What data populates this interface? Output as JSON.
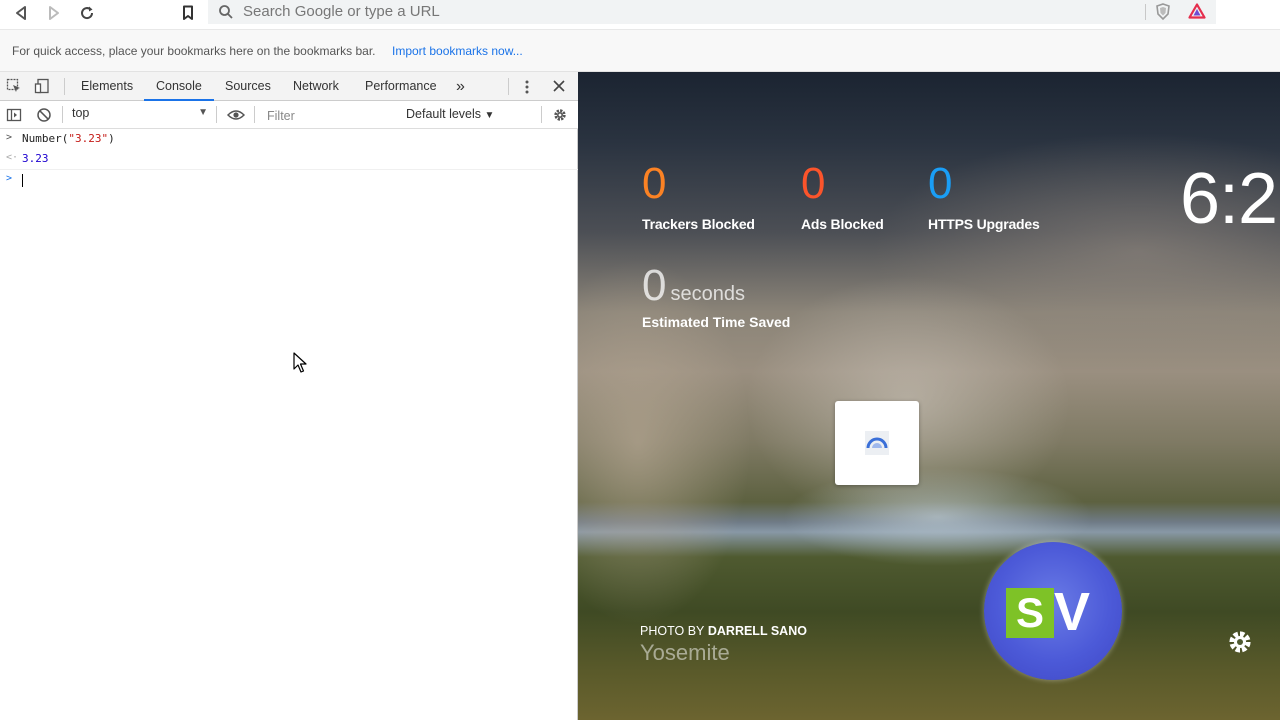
{
  "toolbar": {
    "url_placeholder": "Search Google or type a URL",
    "icons": [
      "back-icon",
      "forward-icon",
      "reload-icon",
      "bookmark-icon",
      "search-icon",
      "brave-shield-icon",
      "brave-rewards-icon"
    ]
  },
  "bookmarks_bar": {
    "hint": "For quick access, place your bookmarks here on the bookmarks bar.",
    "import_link": "Import bookmarks now..."
  },
  "devtools": {
    "tabs": [
      {
        "label": "Elements",
        "active": false
      },
      {
        "label": "Console",
        "active": true
      },
      {
        "label": "Sources",
        "active": false
      },
      {
        "label": "Network",
        "active": false
      },
      {
        "label": "Performance",
        "active": false
      }
    ],
    "more_tabs": "»",
    "console_bar": {
      "context": "top",
      "filter_placeholder": "Filter",
      "levels": "Default levels"
    },
    "console": {
      "command_fn": "Number(",
      "command_arg": "\"3.23\"",
      "command_close": ")",
      "result": "3.23"
    }
  },
  "newtab": {
    "stats": [
      {
        "value": "0",
        "label": "Trackers Blocked",
        "color": "#fb8224"
      },
      {
        "value": "0",
        "label": "Ads Blocked",
        "color": "#fb542b"
      },
      {
        "value": "0",
        "label": "HTTPS Upgrades",
        "color": "#1a9ef6"
      }
    ],
    "time_saved": {
      "value": "0",
      "unit": "seconds",
      "label": "Estimated Time Saved"
    },
    "clock": "6:2",
    "photo_credit": {
      "prefix": "PHOTO BY",
      "author": "DARRELL SANO",
      "location": "Yosemite"
    },
    "badge": {
      "s": "S",
      "v": "V"
    }
  },
  "colors": {
    "accent": "#1a73e8",
    "console_string": "#c41a16",
    "console_number": "#1c00cf"
  }
}
